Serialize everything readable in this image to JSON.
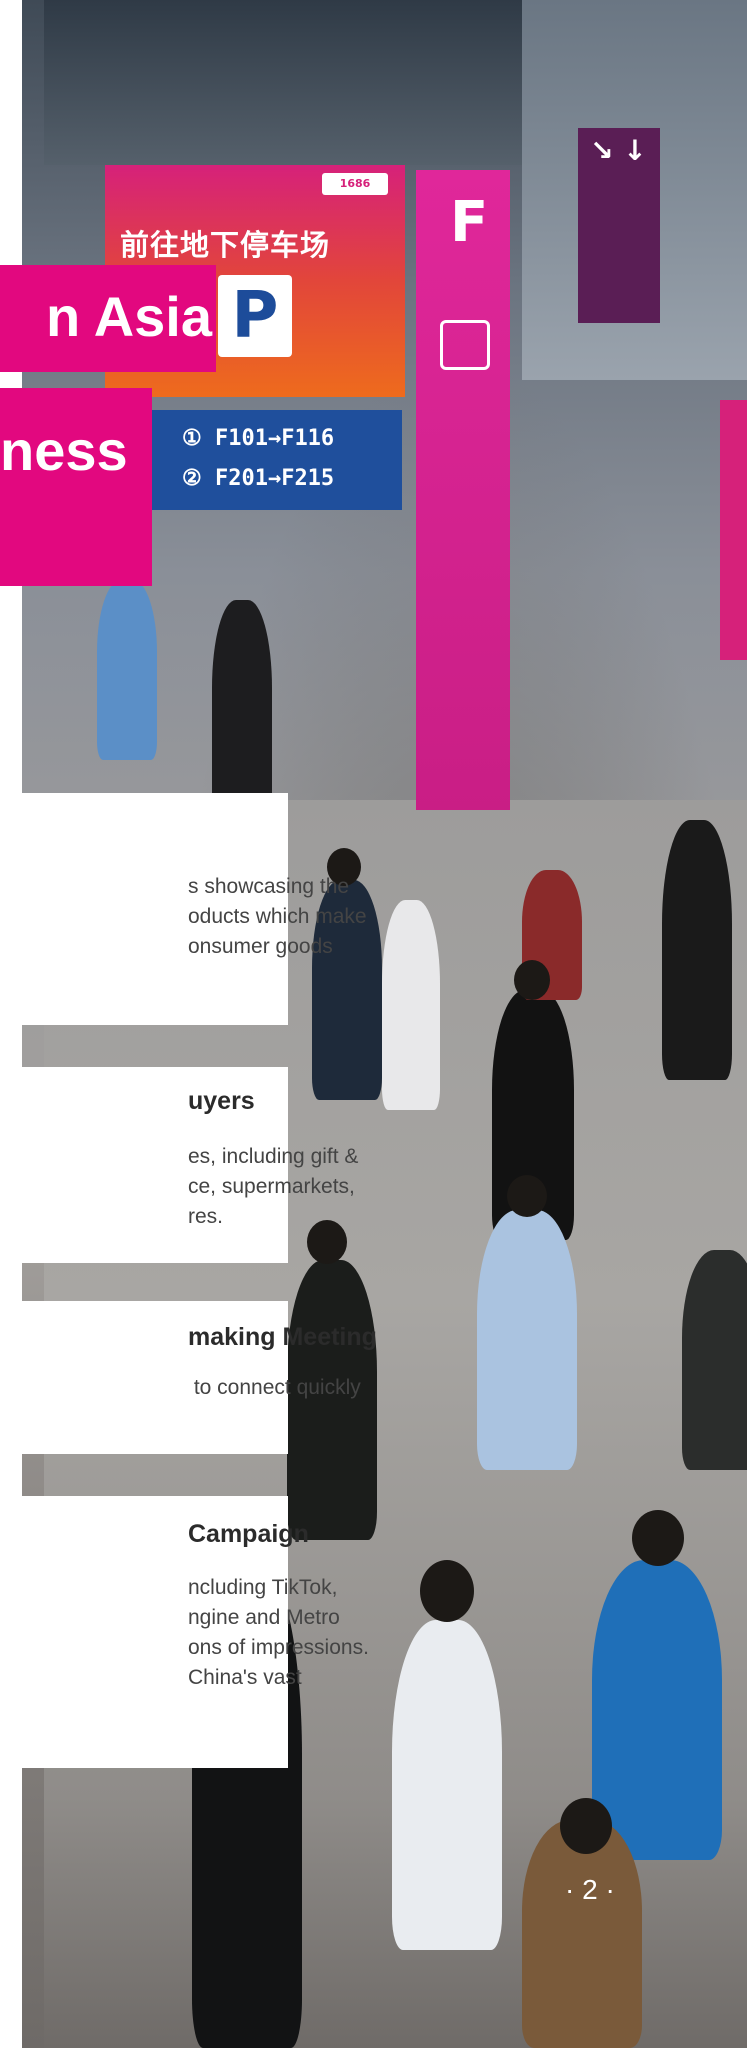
{
  "colors": {
    "accent": "#e2087f",
    "card_bg": "#ffffff",
    "sign_blue": "#1f4f9c"
  },
  "hero": {
    "title_line1": "n Asia",
    "title_line2": "ness"
  },
  "photo_signage": {
    "chinese_sign": "前往地下停车场",
    "badge": "1686",
    "parking": "P",
    "floor_f1": "① F101→F116",
    "floor_f2": "② F201→F215",
    "pillar_letter": "F"
  },
  "cards": [
    {
      "heading": "",
      "lines": [
        "s showcasing the",
        "oducts which make",
        "onsumer goods"
      ]
    },
    {
      "heading": "uyers",
      "lines": [
        "es, including gift &",
        "ce, supermarkets,",
        "res."
      ]
    },
    {
      "heading": "making Meeting",
      "lines": [
        " to connect quickly"
      ]
    },
    {
      "heading": "Campaign",
      "lines": [
        "ncluding TikTok,",
        "ngine and Metro",
        "ons of impressions.",
        "China's vast"
      ]
    }
  ],
  "page_number": "2",
  "icons": [
    "up-down-arrows-icon",
    "down-arrow-icon"
  ]
}
